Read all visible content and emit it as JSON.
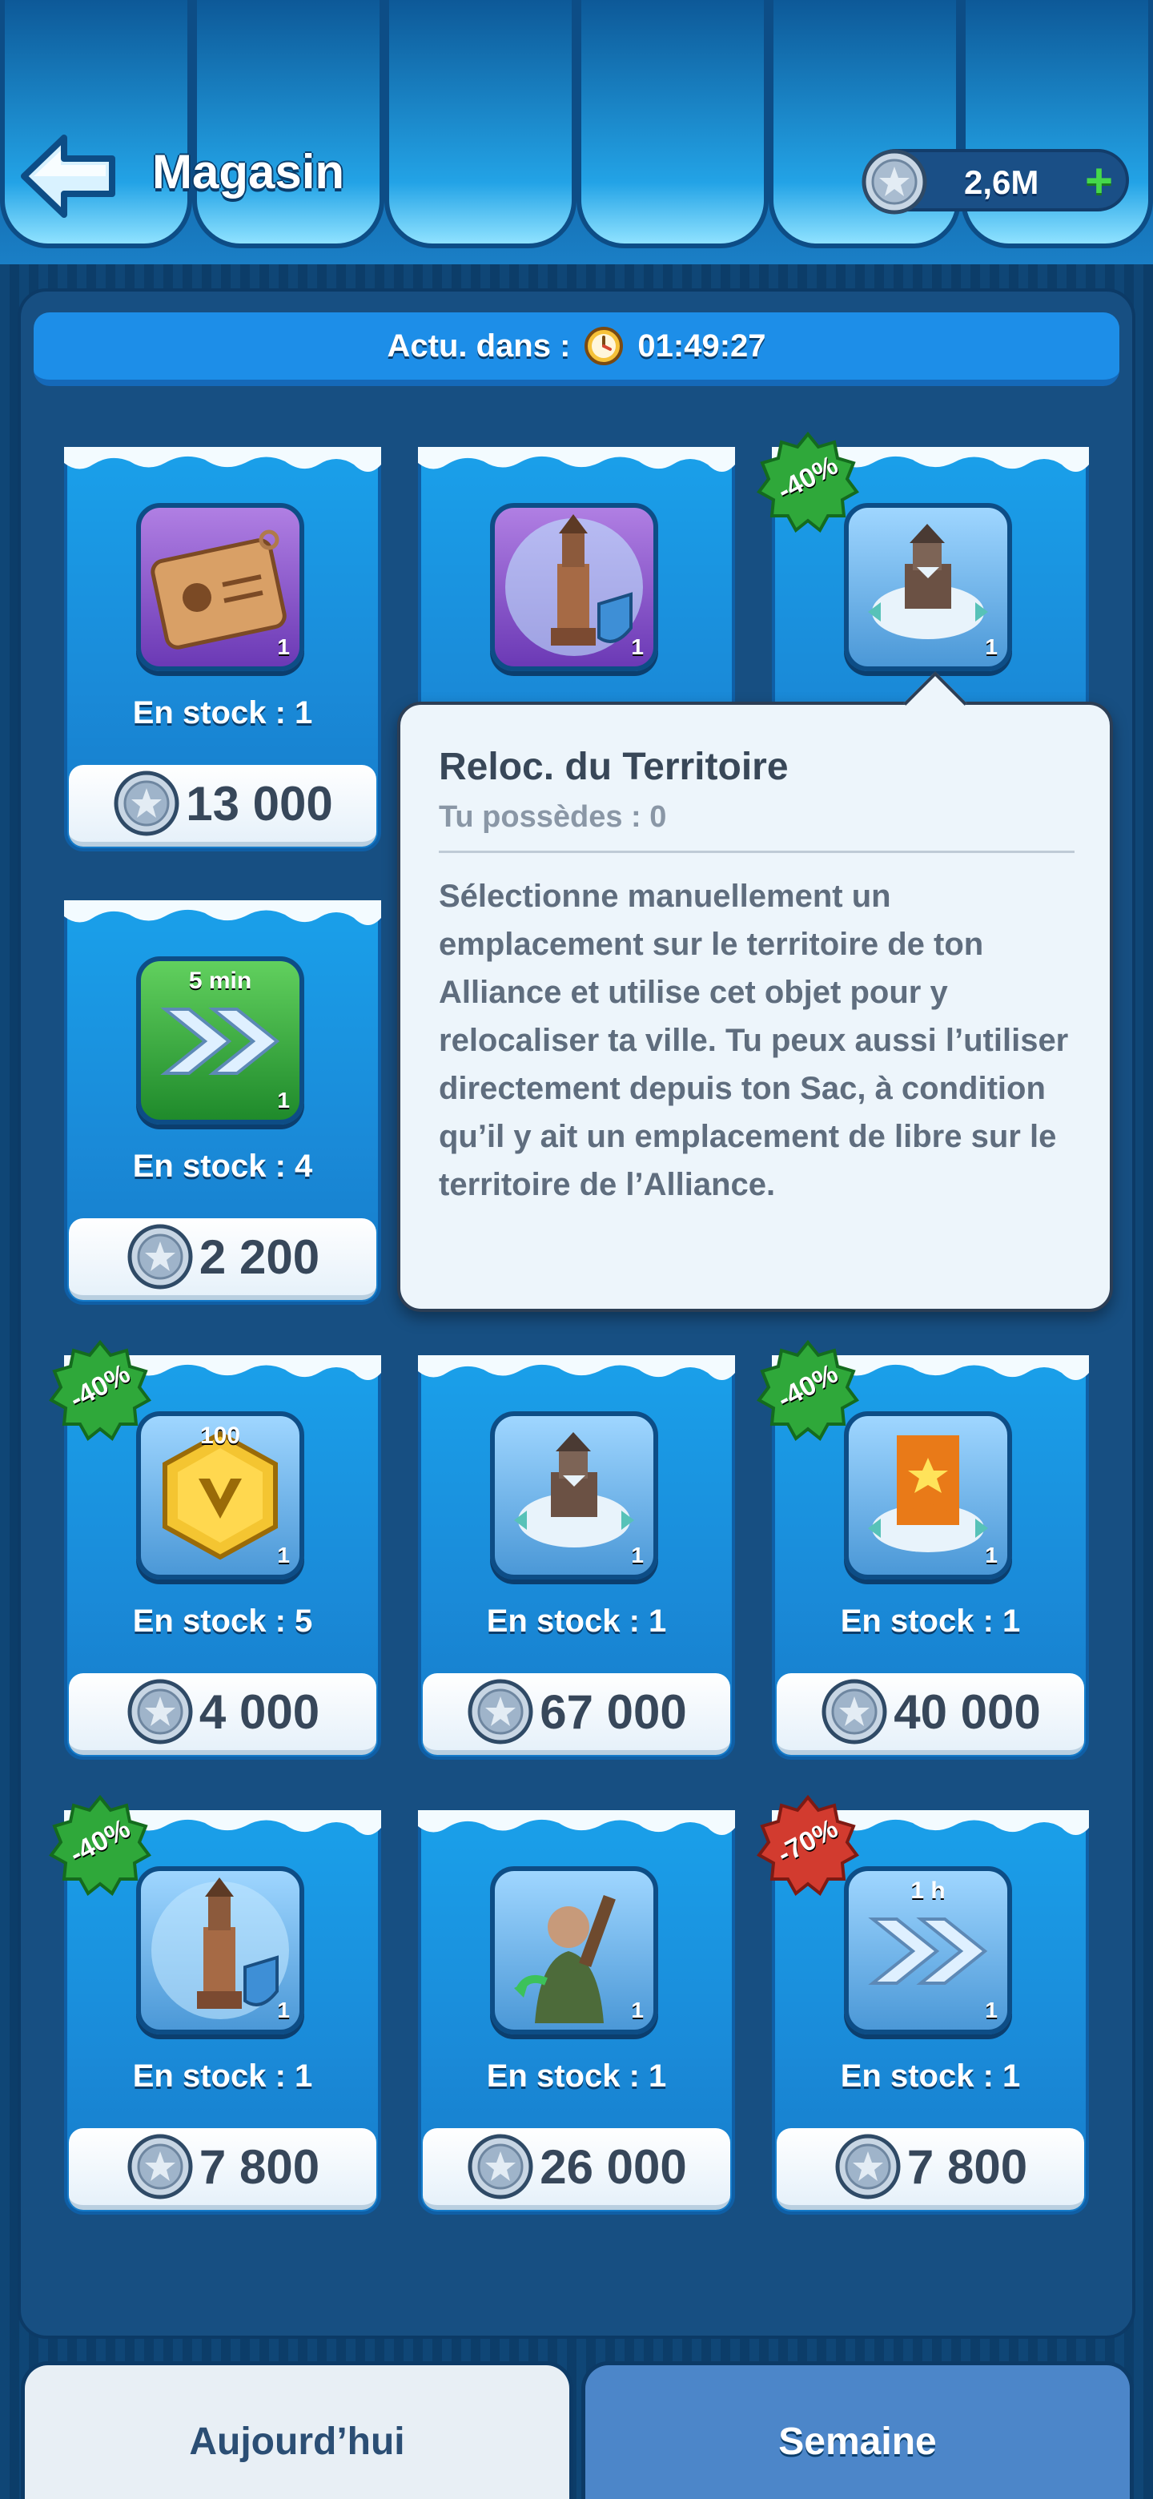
{
  "header": {
    "title": "Magasin",
    "currency_amount": "2,6M",
    "plus_label": "+"
  },
  "refresh": {
    "label": "Actu. dans :",
    "timer": "01:49:27"
  },
  "cards": [
    {
      "stock": "En stock : 1",
      "price": "13 000",
      "qty": "1",
      "icon": "relocation-document-icon",
      "discount": ""
    },
    {
      "stock": "",
      "price": "",
      "qty": "1",
      "icon": "watchtower-shield-icon",
      "discount": ""
    },
    {
      "stock": "",
      "price": "",
      "qty": "1",
      "icon": "territory-relocation-icon",
      "discount": "-40%"
    },
    {
      "stock": "En stock : 4",
      "price": "2 200",
      "qty": "1",
      "icon": "speedup-5min-icon",
      "top_label": "5 min",
      "discount": ""
    },
    {
      "stock": "En stock : 5",
      "price": "4 000",
      "qty": "1",
      "icon": "gold-hexagon-icon",
      "top_label": "100",
      "discount": "-40%"
    },
    {
      "stock": "En stock : 1",
      "price": "67 000",
      "qty": "1",
      "icon": "territory-relocation-icon",
      "discount": ""
    },
    {
      "stock": "En stock : 1",
      "price": "40 000",
      "qty": "1",
      "icon": "alliance-banner-relocation-icon",
      "discount": "-40%"
    },
    {
      "stock": "En stock : 1",
      "price": "7 800",
      "qty": "1",
      "icon": "watchtower-shield-icon",
      "discount": "-40%"
    },
    {
      "stock": "En stock : 1",
      "price": "26 000",
      "qty": "1",
      "icon": "soldier-recruit-icon",
      "discount": ""
    },
    {
      "stock": "En stock : 1",
      "price": "7 800",
      "qty": "1",
      "icon": "speedup-1h-icon",
      "top_label": "1 h",
      "discount": "-70%"
    }
  ],
  "tooltip": {
    "title": "Reloc. du Territoire",
    "owned": "Tu possèdes : 0",
    "description": "Sélectionne manuellement un emplacement sur le territoire de ton Alliance et utilise cet objet pour y relocaliser ta ville. Tu peux aussi l’utiliser directement depuis ton Sac, à condition qu’il y ait un emplacement de libre sur le territoire de l’Alliance."
  },
  "tabs": {
    "today": "Aujourd’hui",
    "week": "Semaine"
  },
  "colors": {
    "discount_green": "#2fa83a",
    "discount_red": "#d23b2f",
    "accent_blue": "#1d8ee8"
  }
}
